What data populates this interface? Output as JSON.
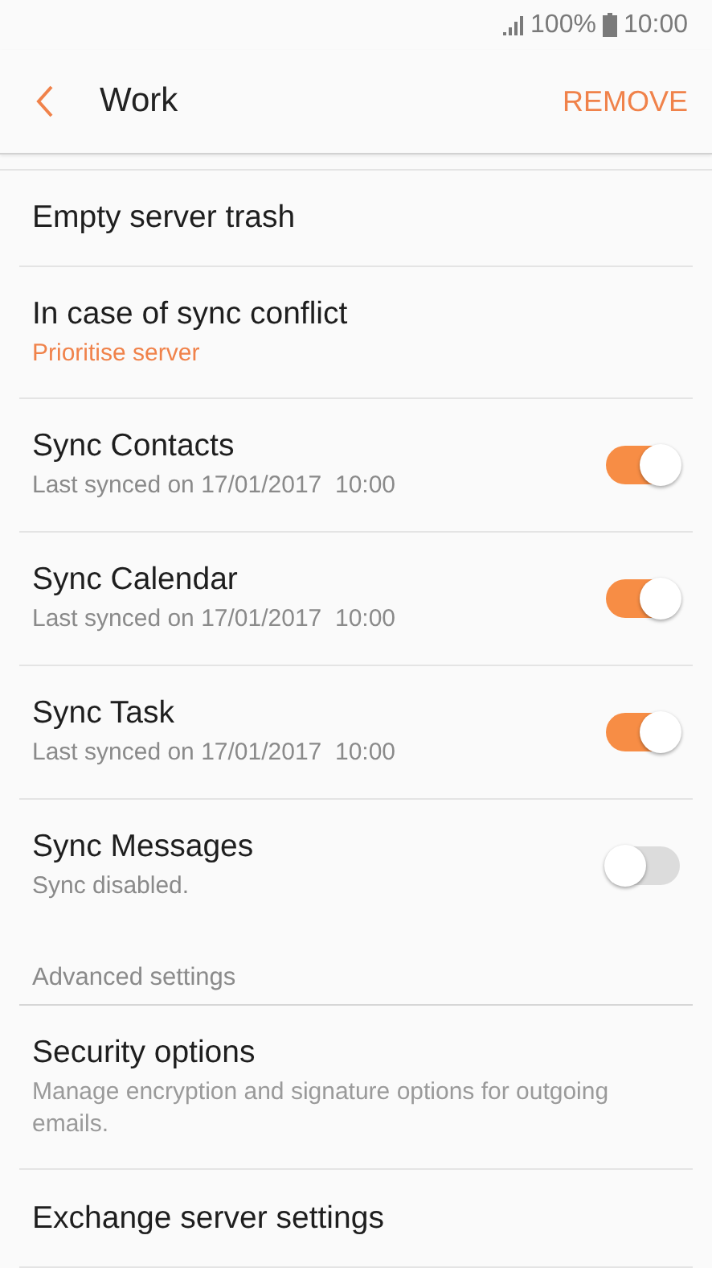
{
  "status_bar": {
    "battery": "100%",
    "time": "10:00"
  },
  "header": {
    "title": "Work",
    "action": "REMOVE"
  },
  "items": [
    {
      "kind": "plain",
      "title": "Empty server trash"
    },
    {
      "kind": "option",
      "title": "In case of sync conflict",
      "subtitle": "Prioritise server"
    },
    {
      "kind": "toggle",
      "title": "Sync Contacts",
      "subtitle": "Last synced on 17/01/2017  10:00",
      "on": true
    },
    {
      "kind": "toggle",
      "title": "Sync Calendar",
      "subtitle": "Last synced on 17/01/2017  10:00",
      "on": true
    },
    {
      "kind": "toggle",
      "title": "Sync Task",
      "subtitle": "Last synced on 17/01/2017  10:00",
      "on": true
    },
    {
      "kind": "toggle",
      "title": "Sync Messages",
      "subtitle": "Sync disabled.",
      "on": false
    },
    {
      "kind": "section",
      "title": "Advanced settings"
    },
    {
      "kind": "info",
      "title": "Security options",
      "subtitle": "Manage encryption and signature options for outgoing emails."
    },
    {
      "kind": "plain",
      "title": "Exchange server settings"
    }
  ]
}
